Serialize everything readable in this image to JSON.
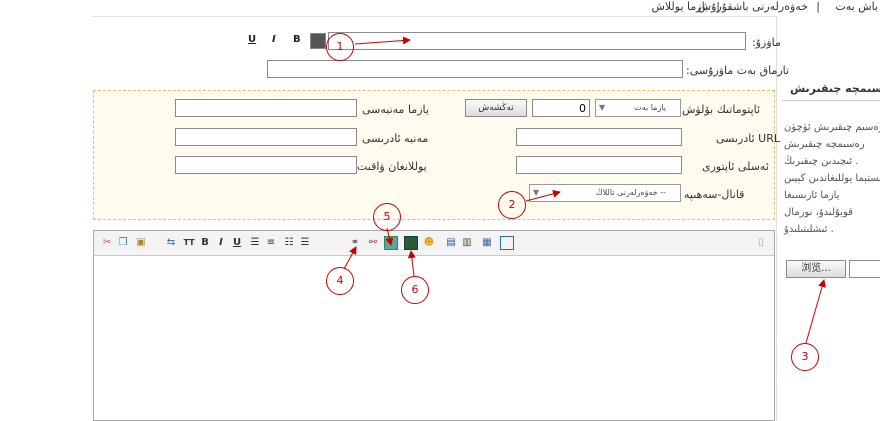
{
  "nav": {
    "home": "باش بەت",
    "sep1": "|",
    "news_mgmt": "خەۋەرلەرنى باشقۇرۇش",
    "sep2": "|",
    "add_new": "يازما يوللاش"
  },
  "form": {
    "title_label": "ماۋزۇ:",
    "title_value": "",
    "format_underline": "U",
    "format_italic": "I",
    "format_bold": "B",
    "link_title_label": "تارماق بەت ماۋزۇسى:",
    "link_title_value": "",
    "auto_page_label": "ئاپتوماتىك بۆلۈش",
    "auto_page_select": "يازما بەت",
    "auto_page_count": "0",
    "auto_page_button": "تەڭشەش",
    "author_label": "يازما مەنبەسى",
    "author_value": "",
    "url_label": "URL ئادرىسى",
    "url_value": "",
    "source_addr_label": "مەنبە ئادرىسى",
    "source_addr_value": "",
    "original_author_label": "ئەسلى ئاپتورى",
    "original_author_value": "",
    "publish_time_label": "يوللانغان ۋاقىت",
    "publish_time_value": "",
    "channel_label": "قانال-سەھىپە",
    "channel_select": "-- خەۋەرلەرنى تاللاڭ"
  },
  "side_panel": {
    "title": "رەسىمچە چىقىرىش",
    "lines": [
      "رەسىم چىقىرىش ئۈچۈن",
      "رەسىمچە چىقىرىش",
      "ئىچىدىن چىقىرىڭ .",
      "سىستېما يوللىغاندىن كېيىن",
      "يازما ئارىسىغا",
      "قويۇلىدۇ، نورمال",
      "ئىشلىتىلىدۇ ."
    ],
    "browse_button": "浏览...",
    "file_value": ""
  },
  "callouts": [
    "1",
    "2",
    "3",
    "4",
    "5",
    "6"
  ],
  "colors": {
    "callout": "#cc0000",
    "settings_bg": "#fffbee",
    "settings_border": "#e4c36a"
  }
}
